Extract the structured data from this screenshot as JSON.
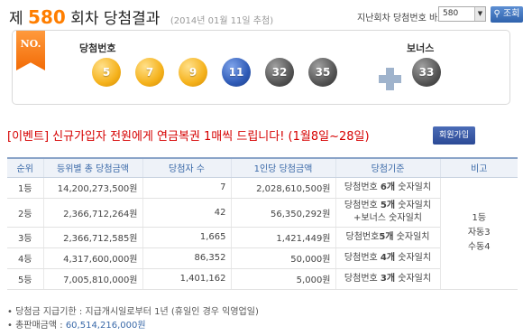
{
  "header": {
    "title_prefix": "제",
    "round": "580",
    "title_suffix": "회차 당첨결과",
    "date": "(2014년 01월 11일 추첨)",
    "jump_label": "지난회차 당첨번호 바로가기",
    "select_value": "580",
    "search_label": "조회"
  },
  "result": {
    "ribbon": "NO.",
    "winning_label": "당첨번호",
    "bonus_label": "보너스",
    "numbers": [
      "5",
      "7",
      "9",
      "11",
      "32",
      "35"
    ],
    "bonus": "33",
    "colors": {
      "yellow": "#f5b21c",
      "blue": "#2f5bb7",
      "gray": "#555555"
    }
  },
  "event": {
    "text": "[이벤트] 신규가입자 전원에게 연금복권 1매씩 드립니다! (1월8일~28일)",
    "button": "회원가입"
  },
  "table": {
    "headers": [
      "순위",
      "등위별 총 당첨금액",
      "당첨자 수",
      "1인당 당첨금액",
      "당첨기준",
      "비고"
    ],
    "rows": [
      {
        "rank": "1등",
        "total": "14,200,273,500원",
        "winners": "7",
        "per": "2,028,610,500원",
        "crit_a": "당첨번호 ",
        "crit_b": "6개",
        "crit_c": " 숫자일치",
        "crit_d": ""
      },
      {
        "rank": "2등",
        "total": "2,366,712,264원",
        "winners": "42",
        "per": "56,350,292원",
        "crit_a": "당첨번호 ",
        "crit_b": "5개",
        "crit_c": " 숫자일치",
        "crit_d": "+보너스 숫자일치"
      },
      {
        "rank": "3등",
        "total": "2,366,712,585원",
        "winners": "1,665",
        "per": "1,421,449원",
        "crit_a": "당첨번호",
        "crit_b": "5개",
        "crit_c": " 숫자일치",
        "crit_d": ""
      },
      {
        "rank": "4등",
        "total": "4,317,600,000원",
        "winners": "86,352",
        "per": "50,000원",
        "crit_a": "당첨번호 ",
        "crit_b": "4개",
        "crit_c": " 숫자일치",
        "crit_d": ""
      },
      {
        "rank": "5등",
        "total": "7,005,810,000원",
        "winners": "1,401,162",
        "per": "5,000원",
        "crit_a": "당첨번호 ",
        "crit_b": "3개",
        "crit_c": " 숫자일치",
        "crit_d": ""
      }
    ],
    "note_lines": [
      "1등",
      "자동3",
      "수동4"
    ]
  },
  "footnotes": {
    "line1": "• 당첨금 지급기한 : 지급개시일로부터 1년 (휴일인 경우 익영업일)",
    "line2_label": "• 총판매금액 : ",
    "line2_value": "60,514,216,000원"
  }
}
